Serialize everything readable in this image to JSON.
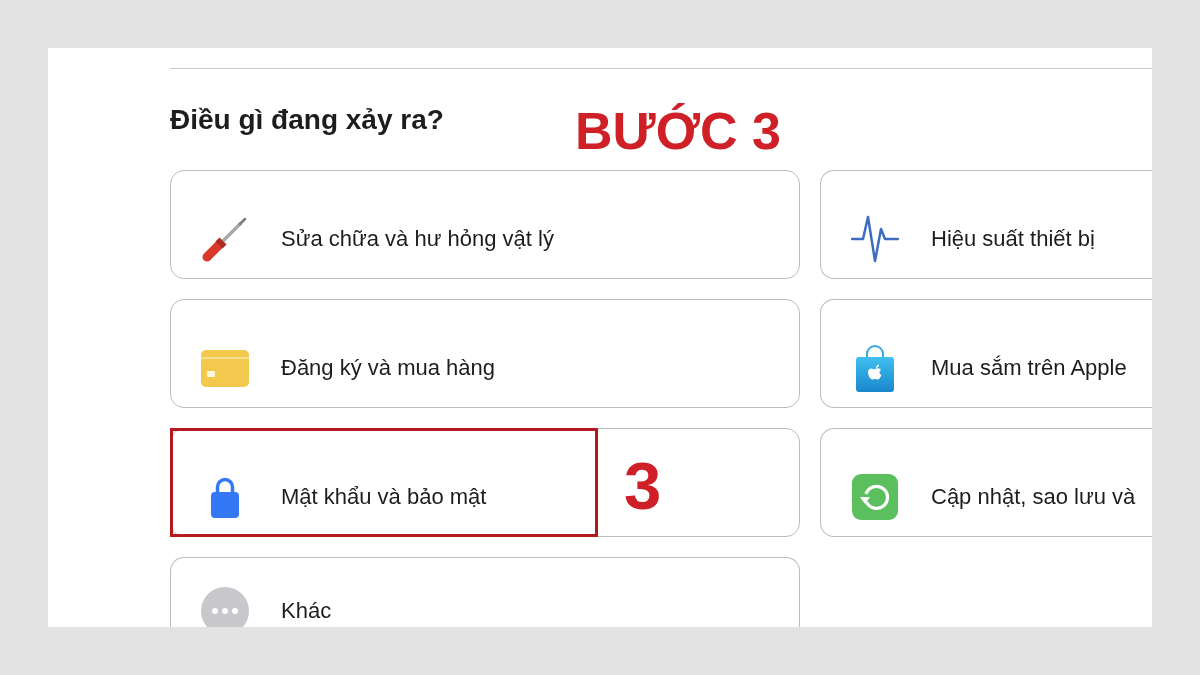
{
  "heading": "Điều gì đang xảy ra?",
  "step_title": "BƯỚC 3",
  "options": [
    {
      "kind": "repair",
      "label": "Sửa chữa và hư hỏng vật lý",
      "highlighted": false
    },
    {
      "kind": "performance",
      "label": "Hiệu suất thiết bị",
      "highlighted": false
    },
    {
      "kind": "billing",
      "label": "Đăng ký và mua hàng",
      "highlighted": false
    },
    {
      "kind": "store",
      "label": "Mua sắm trên Apple",
      "highlighted": false
    },
    {
      "kind": "security",
      "label": "Mật khẩu và bảo mật",
      "highlighted": true,
      "callout": "3"
    },
    {
      "kind": "update",
      "label": "Cập nhật, sao lưu và",
      "highlighted": false
    },
    {
      "kind": "other",
      "label": "Khác",
      "highlighted": false
    }
  ]
}
